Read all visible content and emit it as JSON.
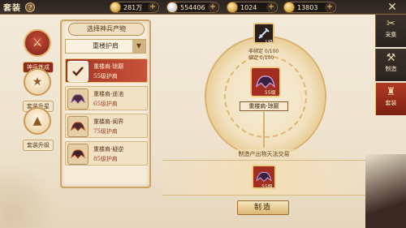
{
  "header": {
    "title": "套装",
    "help": "?",
    "close": "✕"
  },
  "resources": [
    {
      "icon": "coin-icon",
      "value": "281万"
    },
    {
      "icon": "silver-ingot-icon",
      "value": "554406"
    },
    {
      "icon": "scroll-icon",
      "value": "1024"
    },
    {
      "icon": "gold-ingot-icon",
      "value": "13803"
    }
  ],
  "left_nav": [
    {
      "label": "神兵炼成",
      "active": true
    },
    {
      "label": "套装升星",
      "active": false
    },
    {
      "label": "套装升级",
      "active": false
    }
  ],
  "panel": {
    "header": "选择神兵产物",
    "dropdown_value": "重楼护肩",
    "items": [
      {
        "name": "重楼肩·琼巅",
        "level": "55级护肩",
        "active": true
      },
      {
        "name": "重楼肩·遥池",
        "level": "65级护肩",
        "active": false
      },
      {
        "name": "重楼肩·阆界",
        "level": "75级护肩",
        "active": false
      },
      {
        "name": "重楼肩·疑逆",
        "level": "85级护肩",
        "active": false
      }
    ]
  },
  "craft": {
    "material_count": "1级",
    "cost_unbound": "非绑定 0/100",
    "cost_bound": "绑定 0/100",
    "center_level": "55级",
    "center_name": "重楼肩·琼巅",
    "output_label": "制造产出物天法交易",
    "output_level": "55级",
    "make_button": "制造"
  },
  "right_tabs": [
    {
      "label": "采集",
      "icon": "✂",
      "active": false
    },
    {
      "label": "制造",
      "icon": "⚒",
      "active": false
    },
    {
      "label": "套装",
      "icon": "♜",
      "active": true
    }
  ]
}
